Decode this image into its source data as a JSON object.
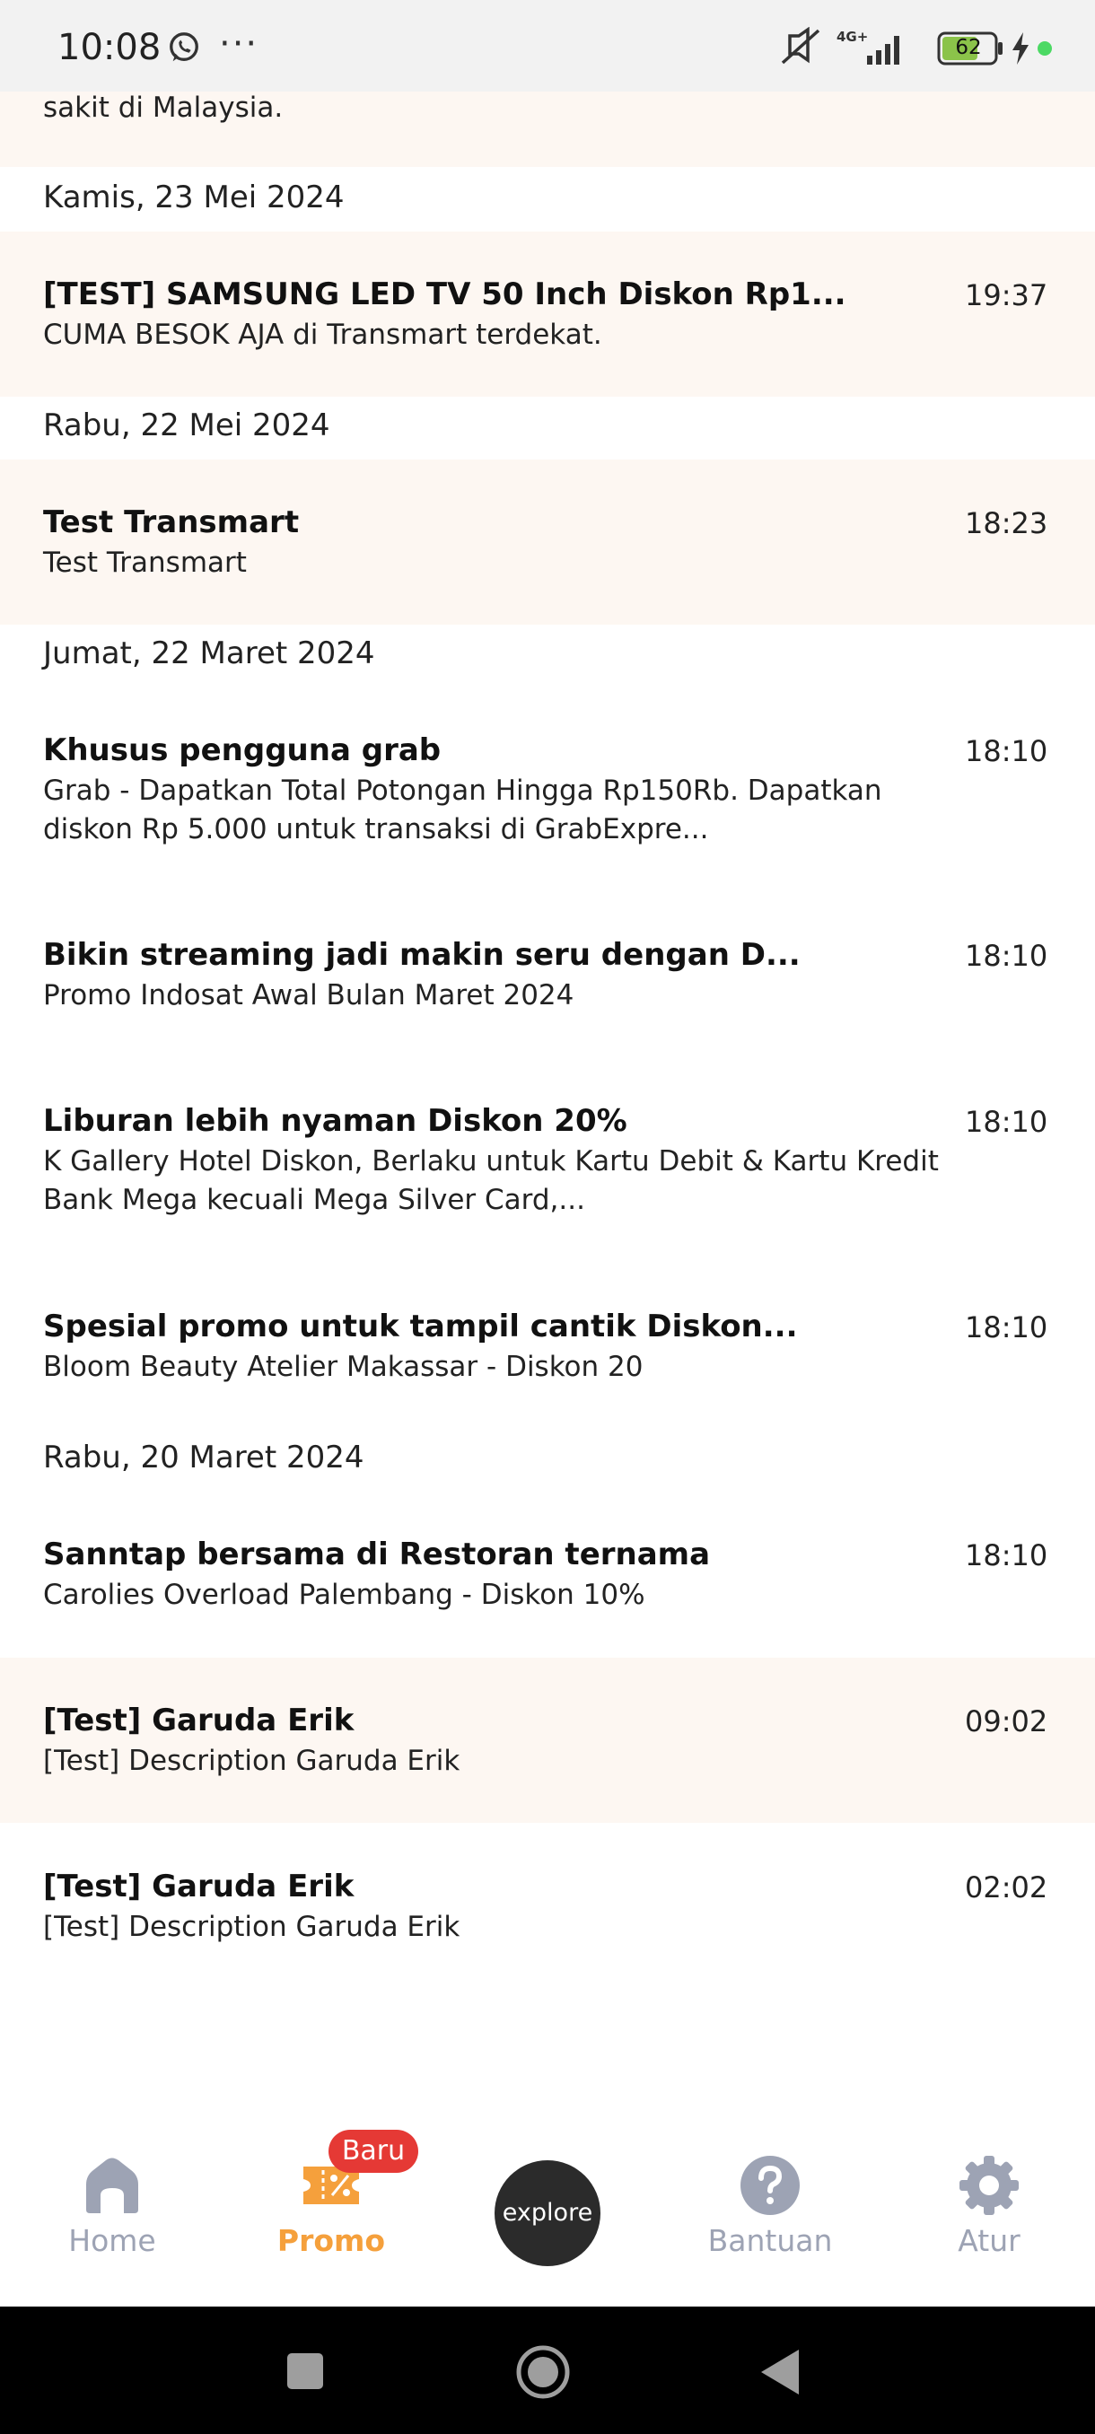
{
  "status_bar": {
    "time": "10:08",
    "dots": "···",
    "battery": "62",
    "network": "4G+"
  },
  "partial_item": {
    "text": "sakit di Malaysia."
  },
  "groups": [
    {
      "date": "Kamis, 23 Mei 2024",
      "items": [
        {
          "title": "[TEST] SAMSUNG LED TV 50 Inch Diskon Rp1...",
          "desc": "CUMA BESOK AJA di Transmart terdekat.",
          "time": "19:37",
          "unread": true
        }
      ]
    },
    {
      "date": "Rabu, 22 Mei 2024",
      "items": [
        {
          "title": "Test Transmart",
          "desc": "Test Transmart",
          "time": "18:23",
          "unread": true
        }
      ]
    },
    {
      "date": "Jumat, 22 Maret 2024",
      "items": [
        {
          "title": "Khusus pengguna grab",
          "desc": "Grab - Dapatkan Total Potongan Hingga Rp150Rb. Dapatkan diskon Rp 5.000 untuk transaksi di GrabExpre...",
          "time": "18:10",
          "unread": false
        },
        {
          "title": "Bikin streaming jadi makin seru dengan D...",
          "desc": "Promo Indosat Awal Bulan Maret 2024",
          "time": "18:10",
          "unread": false
        },
        {
          "title": "Liburan lebih nyaman Diskon 20%",
          "desc": "K Gallery Hotel Diskon, Berlaku untuk Kartu Debit & Kartu Kredit Bank Mega kecuali Mega Silver Card,...",
          "time": "18:10",
          "unread": false
        },
        {
          "title": "Spesial promo untuk tampil cantik Diskon...",
          "desc": "Bloom Beauty Atelier Makassar - Diskon 20",
          "time": "18:10",
          "unread": false
        }
      ]
    },
    {
      "date": "Rabu, 20 Maret 2024",
      "items": [
        {
          "title": "Sanntap bersama di Restoran ternama",
          "desc": "Carolies Overload Palembang - Diskon 10%",
          "time": "18:10",
          "unread": false
        },
        {
          "title": "[Test] Garuda Erik",
          "desc": "[Test] Description Garuda Erik",
          "time": "09:02",
          "unread": true
        },
        {
          "title": "[Test] Garuda Erik",
          "desc": "[Test] Description Garuda Erik",
          "time": "02:02",
          "unread": false
        }
      ]
    }
  ],
  "bottom_nav": {
    "home": "Home",
    "promo": "Promo",
    "promo_badge": "Baru",
    "explore": "explore",
    "help": "Bantuan",
    "settings": "Atur"
  },
  "colors": {
    "accent": "#f5a03c",
    "unread_bg": "#fdf7f2",
    "inactive": "#9da3b4",
    "badge": "#e53935"
  }
}
